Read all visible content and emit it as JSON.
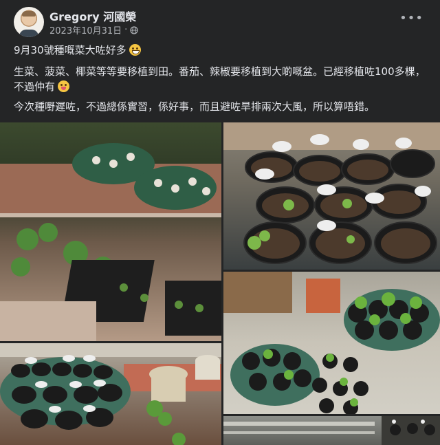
{
  "post": {
    "author": "Gregory 河國榮",
    "date": "2023年10月31日",
    "date_separator": "·",
    "privacy_icon": "globe-icon",
    "more_icon": "ellipsis-icon",
    "line1": "9月30號種嘅菜大咗好多",
    "line1_emoji": "grinning-face-emoji",
    "line2": "生菜、菠菜、椰菜等等要移植到田。番茄、辣椒要移植到大啲嘅盆。已經移植咗100多棵，不過仲有",
    "line2_emoji": "face-savoring-food-emoji",
    "line3": "今次種嘢遲咗，不過總係實習，係好事，而且避咗旱排兩次大風，所以算唔錯。"
  },
  "photos": [
    {
      "subject": "seedling-trays-on-brick-planter"
    },
    {
      "subject": "black-pots-with-labels"
    },
    {
      "subject": "pots-on-green-saucer-patio"
    },
    {
      "subject": "pots-on-green-tray-garden"
    },
    {
      "subject": "balcony-railing-pots"
    }
  ],
  "colors": {
    "background": "#242526",
    "text_primary": "#e4e6eb",
    "text_secondary": "#b0b3b8"
  }
}
